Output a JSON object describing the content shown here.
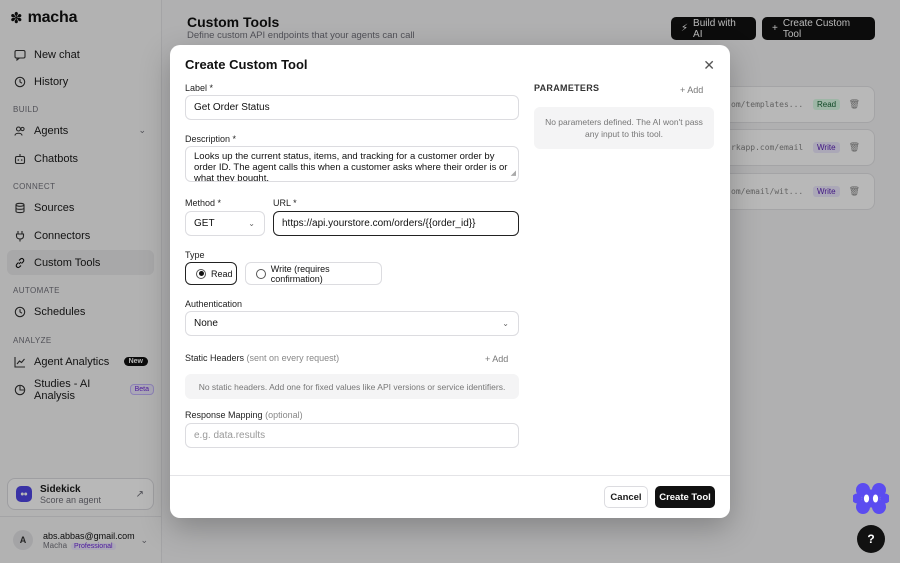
{
  "app": {
    "name": "macha"
  },
  "sidebar": {
    "new_chat": "New chat",
    "history": "History",
    "sections": {
      "build": "BUILD",
      "connect": "CONNECT",
      "automate": "AUTOMATE",
      "analyze": "ANALYZE"
    },
    "items": {
      "agents": "Agents",
      "chatbots": "Chatbots",
      "sources": "Sources",
      "connectors": "Connectors",
      "custom_tools": "Custom Tools",
      "schedules": "Schedules",
      "agent_analytics": "Agent Analytics",
      "studies": "Studies - AI Analysis"
    },
    "badges": {
      "new": "New",
      "beta": "Beta"
    },
    "sidekick": {
      "title": "Sidekick",
      "subtitle": "Score an agent"
    },
    "user": {
      "initial": "A",
      "email": "abs.abbas@gmail.com",
      "org": "Macha",
      "plan": "Professional"
    }
  },
  "main": {
    "title": "Custom Tools",
    "subtitle": "Define custom API endpoints that your agents can call",
    "build_ai_label": "Build with AI",
    "create_label": "Create Custom Tool",
    "tools": [
      {
        "url": "om/templates...",
        "type": "Read"
      },
      {
        "url": "rkapp.com/email",
        "type": "Write"
      },
      {
        "url": "om/email/wit...",
        "type": "Write"
      }
    ]
  },
  "modal": {
    "title": "Create Custom Tool",
    "label_field": {
      "label": "Label *",
      "value": "Get Order Status"
    },
    "description_field": {
      "label": "Description *",
      "value": "Looks up the current status, items, and tracking for a customer order by order ID. The agent calls this when a customer asks where their order is or what they bought."
    },
    "method_field": {
      "label": "Method *",
      "value": "GET"
    },
    "url_field": {
      "label": "URL *",
      "value": "https://api.yourstore.com/orders/{{order_id}}"
    },
    "type": {
      "label": "Type",
      "options": [
        "Read",
        "Write (requires confirmation)"
      ],
      "selected": "Read"
    },
    "authentication": {
      "label": "Authentication",
      "value": "None"
    },
    "static_headers": {
      "label": "Static Headers",
      "hint": "(sent on every request)",
      "add": "+ Add",
      "empty": "No static headers. Add one for fixed values like API versions or service identifiers."
    },
    "response_mapping": {
      "label": "Response Mapping",
      "hint": "(optional)",
      "placeholder": "e.g. data.results"
    },
    "parameters": {
      "heading": "PARAMETERS",
      "add": "+ Add",
      "empty": "No parameters defined. The AI won't pass any input to this tool."
    },
    "cancel_label": "Cancel",
    "submit_label": "Create Tool"
  },
  "colors": {
    "accent": "#111111",
    "brand": "#4f46e5",
    "read_tag": "#dcfce7",
    "write_tag": "#ede9fe"
  }
}
